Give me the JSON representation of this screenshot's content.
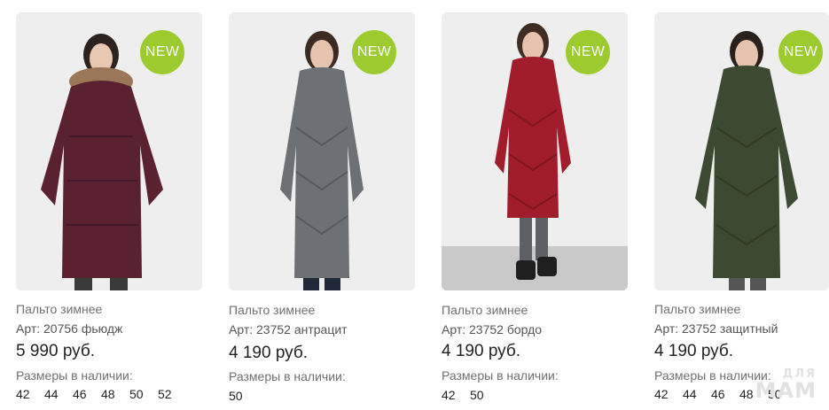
{
  "products": [
    {
      "badge": "NEW",
      "name": "Пальто зимнее",
      "article": "Арт: 20756 фьюдж",
      "price": "5 990 руб.",
      "sizes_label": "Размеры в наличии:",
      "sizes": [
        "42",
        "44",
        "46",
        "48",
        "50",
        "52"
      ],
      "coat_color": "#5a2230",
      "photo_alt": "fur-hood coat photo"
    },
    {
      "badge": "NEW",
      "name": "Пальто зимнее",
      "article": "Арт: 23752 антрацит",
      "price": "4 190 руб.",
      "sizes_label": "Размеры в наличии:",
      "sizes": [
        "50"
      ],
      "coat_color": "#6d7175",
      "photo_alt": "grey coat photo"
    },
    {
      "badge": "NEW",
      "name": "Пальто зимнее",
      "article": "Арт: 23752 бордо",
      "price": "4 190 руб.",
      "sizes_label": "Размеры в наличии:",
      "sizes": [
        "42",
        "50"
      ],
      "coat_color": "#a11d2b",
      "photo_alt": "burgundy coat photo"
    },
    {
      "badge": "NEW",
      "name": "Пальто зимнее",
      "article": "Арт: 23752 защитный",
      "price": "4 190 руб.",
      "sizes_label": "Размеры в наличии:",
      "sizes": [
        "42",
        "44",
        "46",
        "48",
        "50"
      ],
      "coat_color": "#3d4a32",
      "photo_alt": "olive coat photo"
    }
  ],
  "watermark": {
    "line1": "ДЛЯ",
    "line2": "МАМ"
  },
  "colors": {
    "badge": "#9ccb2f"
  }
}
